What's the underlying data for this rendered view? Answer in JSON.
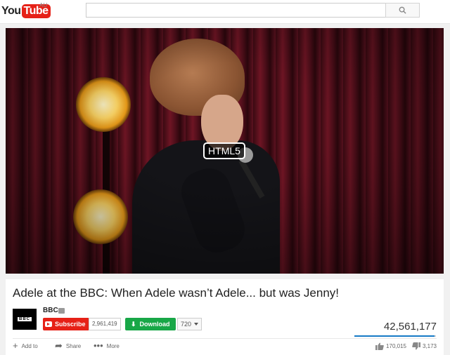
{
  "header": {
    "logo_you": "You",
    "logo_tube": "Tube",
    "region": "AU",
    "search": {
      "value": "",
      "placeholder": ""
    }
  },
  "player": {
    "badge": "HTML5"
  },
  "video": {
    "title": "Adele at the BBC: When Adele wasn’t Adele... but was Jenny!",
    "channel": {
      "avatar_text": "BBC",
      "name": "BBC"
    },
    "subscribe_label": "Subscribe",
    "subscriber_count": "2,961,419",
    "download_label": "Download",
    "quality": "720",
    "views": "42,561,177",
    "like_ratio": 0.98,
    "actions": {
      "add_to": "Add to",
      "share": "Share",
      "more": "More"
    },
    "likes": "170,015",
    "dislikes": "3,173"
  },
  "colors": {
    "brand_red": "#e62117",
    "download_green": "#18a747",
    "views_bar_blue": "#167ac6"
  }
}
